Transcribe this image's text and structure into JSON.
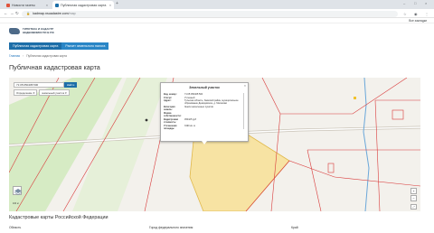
{
  "browser": {
    "tabs": [
      {
        "title": "Новости газеты",
        "favicon_color": "#e0533b"
      },
      {
        "title": "Публичная кадастровая карта",
        "favicon_color": "#1d6ea8"
      }
    ],
    "url_host": "kadmap.nsuadastre.com",
    "url_path": "/map",
    "all_bookmarks": "Все закладки"
  },
  "site": {
    "logo_text": "ГИПОТЕКА И КАДАСТР НЕДВИЖИМОСТИ В РФ",
    "nav": [
      {
        "label": "Публичная кадастровая карта"
      },
      {
        "label": "Расчет земельного налога"
      }
    ],
    "breadcrumbs": [
      "Главная",
      "Публичная кадастровая карта"
    ],
    "page_title": "Публичная кадастровая карта"
  },
  "map": {
    "search_value": "71:05:050405:500",
    "search_button": "Найти",
    "filters": [
      "Определение",
      "земельный участок"
    ],
    "scale_label": "100 м",
    "popup": {
      "title": "Земельный участок",
      "rows": [
        {
          "k": "Кад. номер:",
          "v": "71:05:050405:500"
        },
        {
          "k": "Статус:",
          "v": "Учтенный"
        },
        {
          "k": "Адрес:",
          "v": "Тульская область, Заокский район, муниципальное образование Демидовское, д. Малахово"
        },
        {
          "k": "Категория земель:",
          "v": "Земли населенных пунктов"
        },
        {
          "k": "Форма собственности:",
          "v": ""
        },
        {
          "k": "Кадастровая стоимость:",
          "v": "450425 руб"
        },
        {
          "k": "Уточненная площадь:",
          "v": "3190 кв. м"
        }
      ]
    }
  },
  "section": {
    "title": "Кадастровые карты Российской Федерации",
    "columns": [
      "Область",
      "Город федерального значения",
      "Край"
    ]
  }
}
